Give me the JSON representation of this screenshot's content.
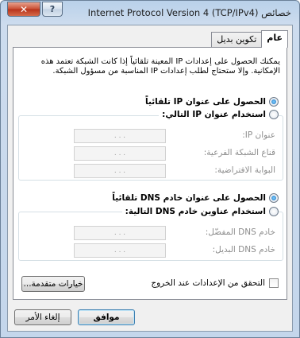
{
  "window": {
    "title": "خصائص Internet Protocol Version 4 (TCP/IPv4)",
    "close_glyph": "✕",
    "help_glyph": "?"
  },
  "tabs": [
    {
      "label": "عام",
      "active": true
    },
    {
      "label": "تكوين بديل",
      "active": false
    }
  ],
  "description": "يمكنك الحصول على إعدادات IP المعينة تلقائياً إذا كانت الشبكة تعتمد هذه الإمكانية. وإلا ستحتاج لطلب إعدادات IP المناسبة من مسؤول الشبكة.",
  "ip": {
    "auto_label": "الحصول على عنوان IP تلقائياً",
    "manual_label": "استخدام عنوان IP التالي:",
    "auto_checked": true,
    "fields": [
      {
        "label": "عنوان IP:",
        "value": ". . ."
      },
      {
        "label": "قناع الشبكة الفرعية:",
        "value": ". . ."
      },
      {
        "label": "البوابة الافتراضية:",
        "value": ". . ."
      }
    ]
  },
  "dns": {
    "auto_label": "الحصول على عنوان خادم DNS تلقائياً",
    "manual_label": "استخدام عناوين خادم DNS التالية:",
    "auto_checked": true,
    "fields": [
      {
        "label": "خادم DNS المفضّل:",
        "value": ". . ."
      },
      {
        "label": "خادم DNS البديل:",
        "value": ". . ."
      }
    ]
  },
  "validate_label": "التحقق من الإعدادات عند الخروج",
  "advanced_button": "خيارات متقدمة...",
  "ok_button": "موافق",
  "cancel_button": "إلغاء الأمر"
}
